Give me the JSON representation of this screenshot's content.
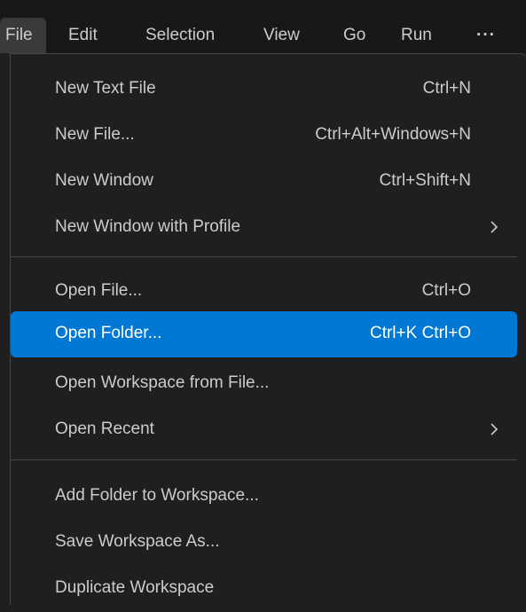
{
  "colors": {
    "menubar_background": "#181818",
    "menu_background": "#1f1f1f",
    "highlight": "#0078d4",
    "separator": "#454545",
    "text": "#cccccc"
  },
  "menubar": {
    "items": [
      {
        "label": "File",
        "active": true
      },
      {
        "label": "Edit"
      },
      {
        "label": "Selection"
      },
      {
        "label": "View"
      },
      {
        "label": "Go"
      },
      {
        "label": "Run"
      },
      {
        "label": "···"
      }
    ]
  },
  "file_menu": {
    "groups": [
      {
        "items": [
          {
            "label": "New Text File",
            "shortcut": "Ctrl+N"
          },
          {
            "label": "New File...",
            "shortcut": "Ctrl+Alt+Windows+N"
          },
          {
            "label": "New Window",
            "shortcut": "Ctrl+Shift+N"
          },
          {
            "label": "New Window with Profile",
            "submenu_icon": "chevron-right-icon"
          }
        ]
      },
      {
        "items": [
          {
            "label": "Open File...",
            "shortcut": "Ctrl+O"
          },
          {
            "label": "Open Folder...",
            "shortcut": "Ctrl+K Ctrl+O",
            "highlighted": true
          },
          {
            "label": "Open Workspace from File..."
          },
          {
            "label": "Open Recent",
            "submenu_icon": "chevron-right-icon"
          }
        ]
      },
      {
        "items": [
          {
            "label": "Add Folder to Workspace..."
          },
          {
            "label": "Save Workspace As..."
          },
          {
            "label": "Duplicate Workspace"
          }
        ]
      }
    ]
  }
}
